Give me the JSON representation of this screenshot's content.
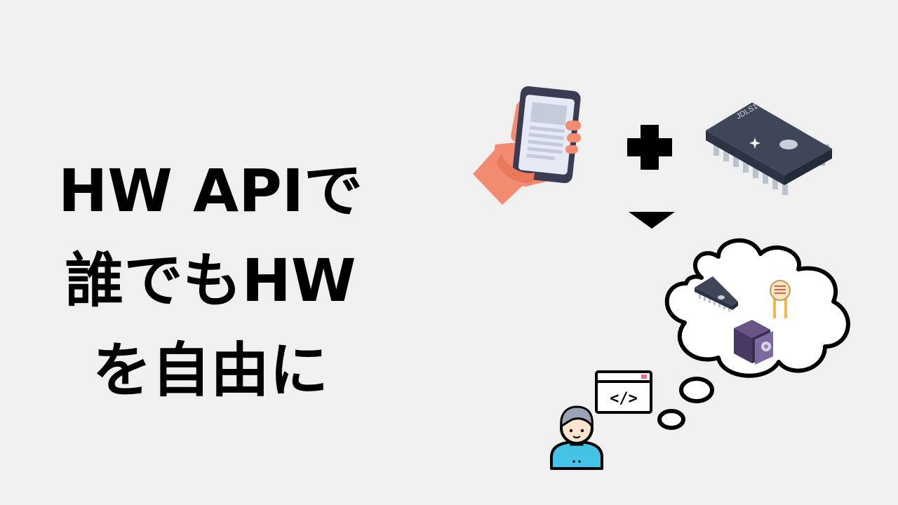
{
  "headline": {
    "lines": [
      "HW APIで",
      "誰でもHW",
      "を自由に"
    ]
  },
  "chip_marking": "JDLS1",
  "code_window_glyph": "</>",
  "colors": {
    "background": "#f0f0f0",
    "text": "#000000",
    "hand": "#f28b6f",
    "phone_body": "#3a3d52",
    "phone_screen": "#e6eaf5",
    "chip_body": "#3e4658",
    "chip_pins": "#bcc3cf",
    "motor": "#4a3a63",
    "sensor_pins": "#f2b94a",
    "person_shirt": "#45c3e6",
    "person_skin": "#fde4cc",
    "person_hair": "#9aa3b5"
  },
  "icons": {
    "hand_phone": "hand-holding-smartphone-icon",
    "plus": "plus-icon",
    "arrow": "down-triangle-arrow-icon",
    "chip": "ic-chip-icon",
    "thought_bubble": "thought-cloud-icon",
    "small_chip": "small-chip-icon",
    "light_sensor": "photoresistor-icon",
    "motor": "stepper-motor-icon",
    "code_window": "code-window-icon",
    "person": "developer-person-icon"
  }
}
